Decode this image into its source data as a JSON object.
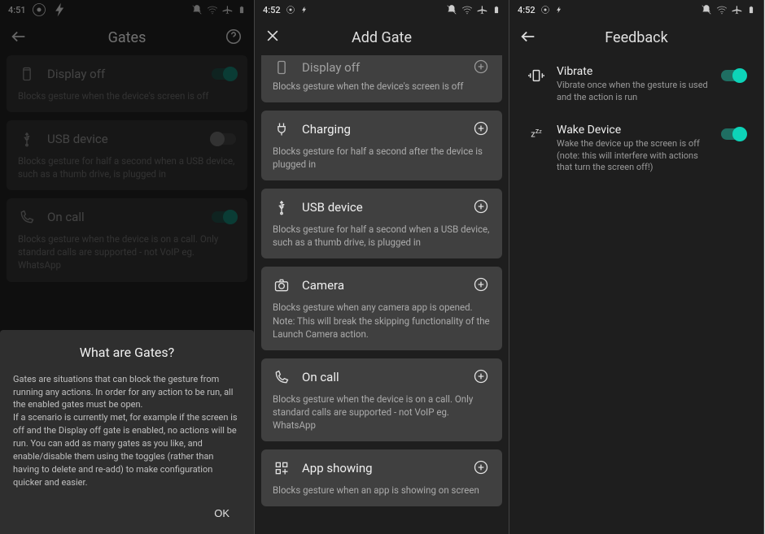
{
  "screen1": {
    "time": "4:51",
    "title": "Gates",
    "gates": [
      {
        "icon": "display",
        "title": "Display off",
        "desc": "Blocks gesture when the device's screen is off",
        "on": true
      },
      {
        "icon": "usb",
        "title": "USB device",
        "desc": "Blocks gesture for half a second when a USB device, such as a thumb drive, is plugged in",
        "on": false
      },
      {
        "icon": "phone",
        "title": "On call",
        "desc": "Blocks gesture when the device is on a call. Only standard calls are supported - not VoIP eg. WhatsApp",
        "on": true
      }
    ],
    "dialog": {
      "title": "What are Gates?",
      "body": "Gates are situations that can block the gesture from running any actions. In order for any action to be run, all the enabled gates must be open.\nIf a scenario is currently met, for example if the screen is off and the Display off gate is enabled, no actions will be run. You can add as many gates as you like, and enable/disable them using the toggles (rather than having to delete and re-add) to make configuration quicker and easier.",
      "ok": "OK"
    }
  },
  "screen2": {
    "time": "4:52",
    "title": "Add Gate",
    "partial_top_title": "Display off",
    "partial_desc": "Blocks gesture when the device's screen is off",
    "gates": [
      {
        "icon": "plug",
        "title": "Charging",
        "desc": "Blocks gesture for half a second after the device is plugged in"
      },
      {
        "icon": "usb",
        "title": "USB device",
        "desc": "Blocks gesture for half a second when a USB device, such as a thumb drive, is plugged in"
      },
      {
        "icon": "camera",
        "title": "Camera",
        "desc": "Blocks gesture when any camera app is opened. Note: This will break the skipping functionality of the Launch Camera action."
      },
      {
        "icon": "phone",
        "title": "On call",
        "desc": "Blocks gesture when the device is on a call. Only standard calls are supported - not VoIP eg. WhatsApp"
      },
      {
        "icon": "apps",
        "title": "App showing",
        "desc": "Blocks gesture when an app is showing on screen"
      }
    ]
  },
  "screen3": {
    "time": "4:52",
    "title": "Feedback",
    "items": [
      {
        "icon": "vibrate",
        "title": "Vibrate",
        "desc": "Vibrate once when the gesture is used and the action is run",
        "on": true
      },
      {
        "icon": "sleep",
        "title": "Wake Device",
        "desc": "Wake the device up the screen is off (note: this will interfere with actions that turn the screen off!)",
        "on": true
      }
    ]
  }
}
